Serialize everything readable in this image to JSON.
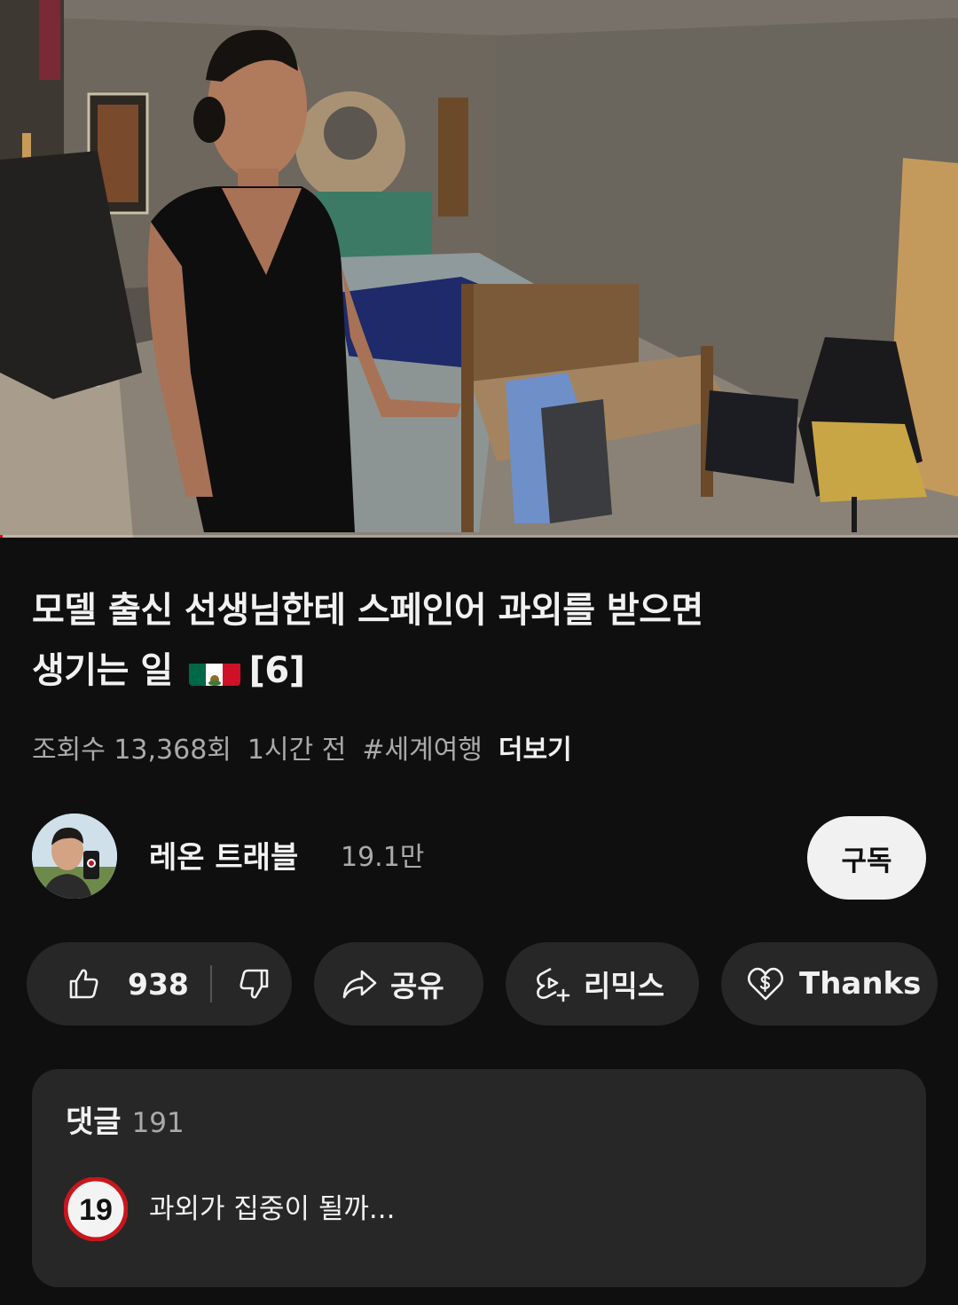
{
  "video": {
    "progress_fraction": 0.003
  },
  "title": {
    "line1": "모델 출신 선생님한테 스페인어 과외를 받으면",
    "line2_text": "생기는 일",
    "flag_icon": "mexico-flag-icon",
    "line2_suffix": "[6]"
  },
  "meta": {
    "views": "조회수 13,368회",
    "time": "1시간 전",
    "hashtag": "#세계여행",
    "more": "더보기"
  },
  "channel": {
    "name": "레온 트래블",
    "subscribers": "19.1만",
    "subscribe_label": "구독"
  },
  "actions": {
    "like_count": "938",
    "share_label": "공유",
    "remix_label": "리믹스",
    "thanks_label": "Thanks"
  },
  "comments": {
    "label": "댓글",
    "count": "191",
    "top_comment": {
      "avatar_text": "19",
      "text": "과외가 집중이 될까..."
    }
  },
  "colors": {
    "background": "#0f0f0f",
    "pill": "#272727",
    "progress": "#ff0000",
    "secondary_text": "#aaaaaa"
  }
}
